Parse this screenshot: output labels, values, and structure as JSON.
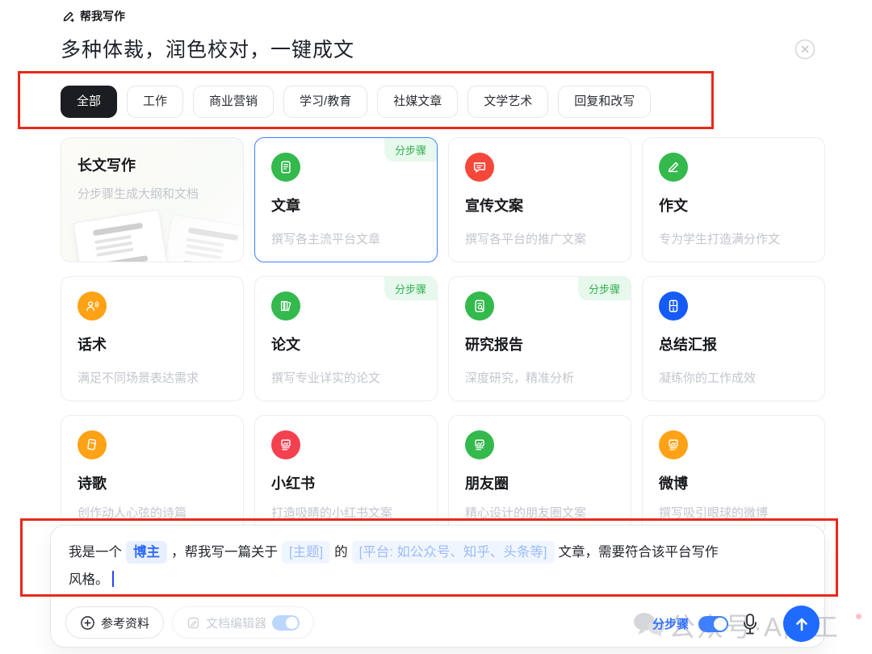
{
  "app": {
    "label": "帮我写作",
    "title": "多种体裁，润色校对，一键成文"
  },
  "tabs": [
    {
      "label": "全部",
      "active": true
    },
    {
      "label": "工作",
      "active": false
    },
    {
      "label": "商业营销",
      "active": false
    },
    {
      "label": "学习/教育",
      "active": false
    },
    {
      "label": "社媒文章",
      "active": false
    },
    {
      "label": "文学艺术",
      "active": false
    },
    {
      "label": "回复和改写",
      "active": false
    }
  ],
  "cards": [
    {
      "title": "长文写作",
      "subtitle": "分步骤生成大纲和文档",
      "badge": "",
      "icon": "document-stack-illustration",
      "selected": false
    },
    {
      "title": "文章",
      "subtitle": "撰写各主流平台文章",
      "badge": "分步骤",
      "icon": "article-doc-icon",
      "color": "#33b94c",
      "selected": true
    },
    {
      "title": "宣传文案",
      "subtitle": "撰写各平台的推广文案",
      "badge": "",
      "icon": "speech-bubble-icon",
      "color": "#f5483b",
      "selected": false
    },
    {
      "title": "作文",
      "subtitle": "专为学生打造满分作文",
      "badge": "",
      "icon": "pencil-icon",
      "color": "#33b94c",
      "selected": false
    },
    {
      "title": "话术",
      "subtitle": "满足不同场景表达需求",
      "badge": "",
      "icon": "person-voice-icon",
      "color": "#ffa216",
      "selected": false
    },
    {
      "title": "论文",
      "subtitle": "撰写专业详实的论文",
      "badge": "分步骤",
      "icon": "books-icon",
      "color": "#33b94c",
      "selected": false
    },
    {
      "title": "研究报告",
      "subtitle": "深度研究，精准分析",
      "badge": "分步骤",
      "icon": "doc-magnifier-icon",
      "color": "#33b94c",
      "selected": false
    },
    {
      "title": "总结汇报",
      "subtitle": "凝练你的工作成效",
      "badge": "",
      "icon": "report-doc-icon",
      "color": "#155bf7",
      "selected": false
    },
    {
      "title": "诗歌",
      "subtitle": "创作动人心弦的诗篇",
      "badge": "",
      "icon": "poem-book-icon",
      "color": "#ffa216",
      "selected": false
    },
    {
      "title": "小红书",
      "subtitle": "打造吸睛的小红书文案",
      "badge": "",
      "icon": "image-post-icon",
      "color": "#f5414f",
      "selected": false
    },
    {
      "title": "朋友圈",
      "subtitle": "精心设计的朋友圈文案",
      "badge": "",
      "icon": "image-post-icon",
      "color": "#33b94c",
      "selected": false
    },
    {
      "title": "微博",
      "subtitle": "撰写吸引眼球的微博",
      "badge": "",
      "icon": "image-post-icon",
      "color": "#ffa216",
      "selected": false
    }
  ],
  "composer": {
    "line1_segments": [
      {
        "type": "text",
        "value": "我是一个"
      },
      {
        "type": "chip-filled",
        "value": "博主"
      },
      {
        "type": "text",
        "value": "，帮我写一篇关于"
      },
      {
        "type": "chip",
        "value": "[主题]"
      },
      {
        "type": "text",
        "value": "的"
      },
      {
        "type": "chip",
        "value": "[平台: 如公众号、知乎、头条等]"
      },
      {
        "type": "text",
        "value": "文章，需要符合该平台写作"
      }
    ],
    "line2": "风格。"
  },
  "toolbar": {
    "reference_button": "参考资料",
    "doc_editor_button": "文档编辑器",
    "doc_editor_toggle_on": true,
    "step_mode_label": "分步骤",
    "step_mode_toggle_on": true
  },
  "watermark": {
    "text": "公众号·A陈工"
  },
  "colors": {
    "accent_blue": "#3370ff",
    "send_blue": "#1f6bff",
    "tab_active_bg": "#1b1d21",
    "badge_green_bg": "#e7f8ec",
    "badge_green_text": "#30b14e",
    "annotation_red": "#e8291c",
    "icon_green": "#33b94c",
    "icon_red": "#f5483b",
    "icon_orange": "#ffa216",
    "icon_blue": "#155bf7",
    "icon_pink": "#f5414f",
    "chip_filled_text": "#2f6bff",
    "chip_ghost_text": "#9cbcf9"
  }
}
